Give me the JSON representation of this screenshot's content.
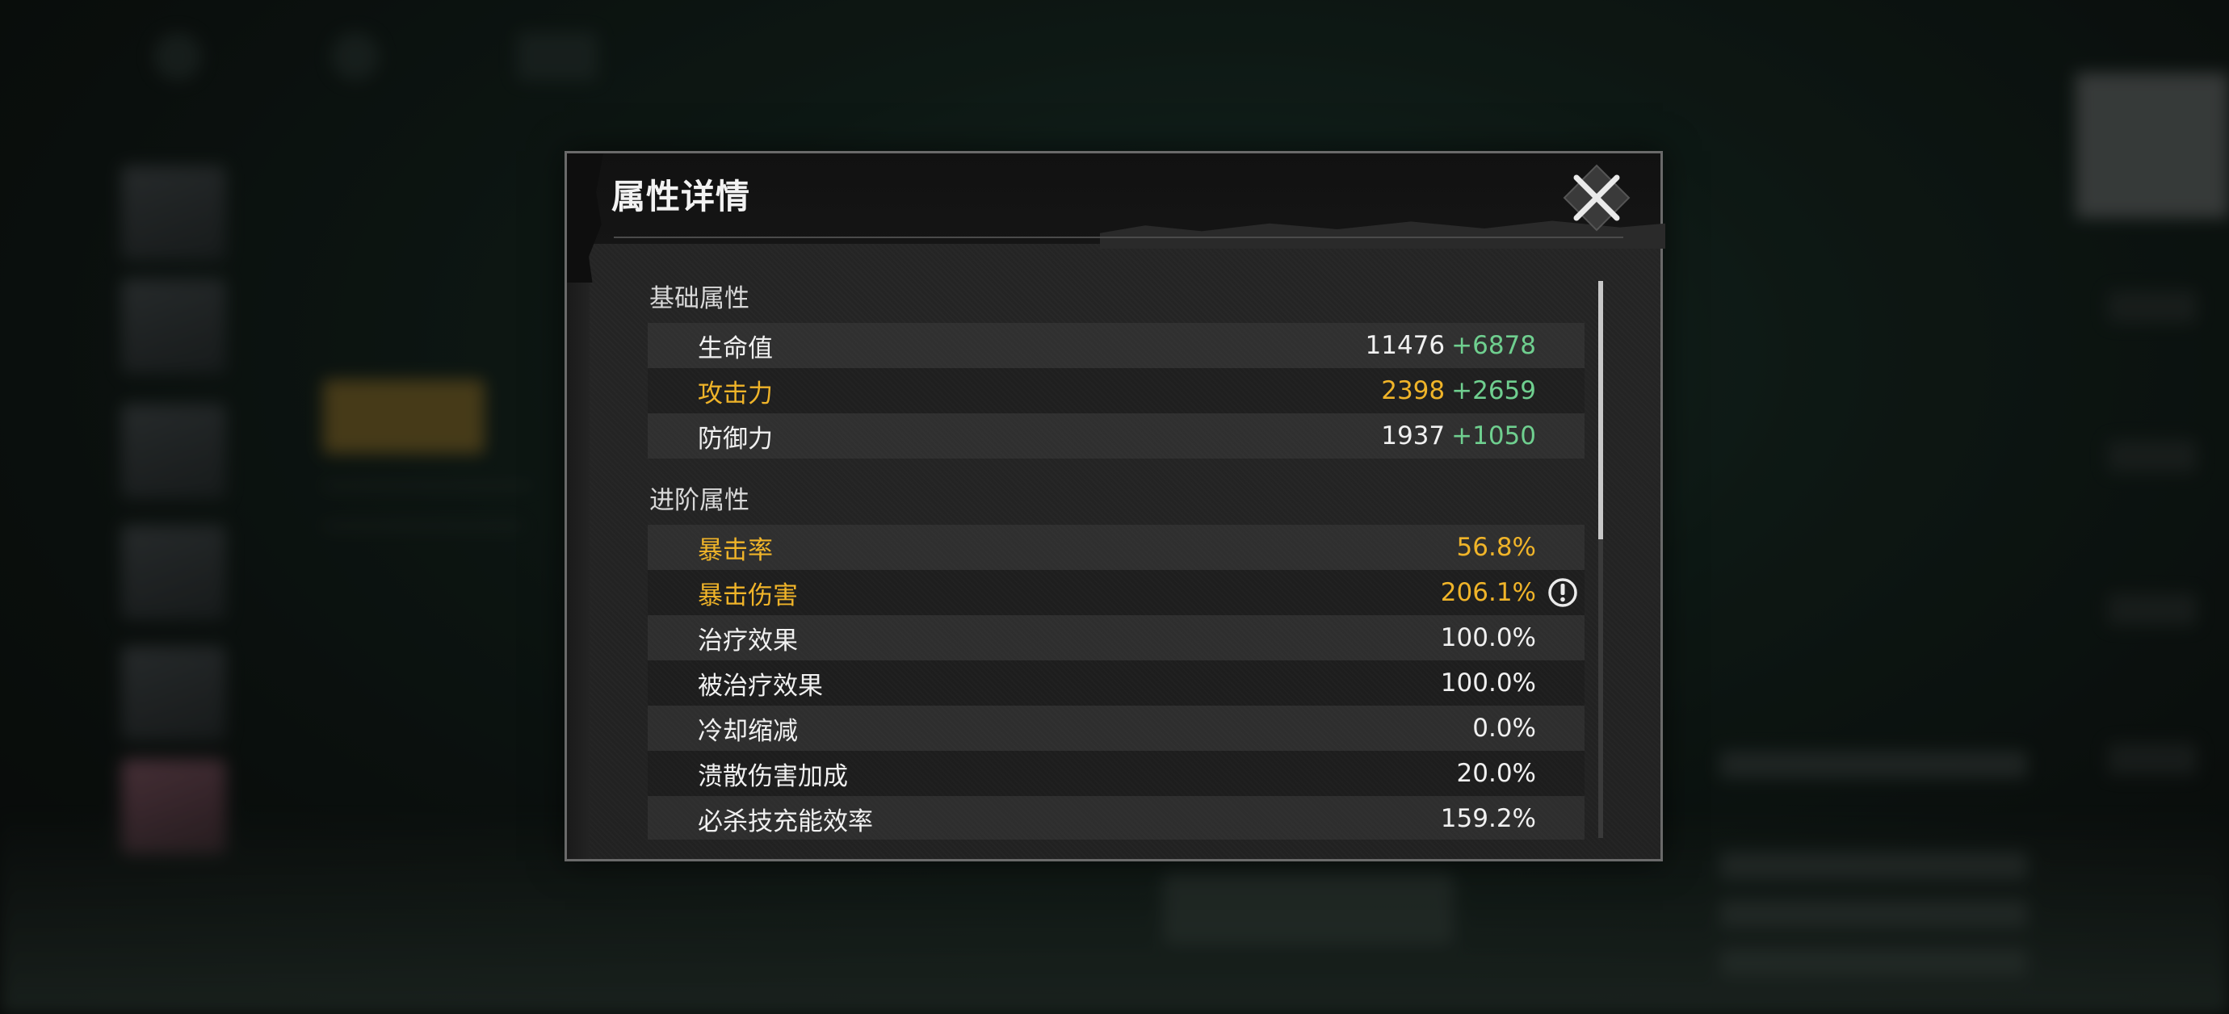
{
  "modal": {
    "title": "属性详情"
  },
  "sections": {
    "basic": {
      "title": "基础属性",
      "rows": [
        {
          "label": "生命值",
          "value": "11476",
          "bonus": "+6878",
          "highlight": false
        },
        {
          "label": "攻击力",
          "value": "2398",
          "bonus": "+2659",
          "highlight": true
        },
        {
          "label": "防御力",
          "value": "1937",
          "bonus": "+1050",
          "highlight": false
        }
      ]
    },
    "advanced": {
      "title": "进阶属性",
      "rows": [
        {
          "label": "暴击率",
          "value": "56.8%",
          "highlight": true
        },
        {
          "label": "暴击伤害",
          "value": "206.1%",
          "highlight": true,
          "icon": "warning-circle-icon"
        },
        {
          "label": "治疗效果",
          "value": "100.0%",
          "highlight": false
        },
        {
          "label": "被治疗效果",
          "value": "100.0%",
          "highlight": false
        },
        {
          "label": "冷却缩减",
          "value": "0.0%",
          "highlight": false
        },
        {
          "label": "溃散伤害加成",
          "value": "20.0%",
          "highlight": false
        },
        {
          "label": "必杀技充能效率",
          "value": "159.2%",
          "highlight": false
        }
      ]
    }
  },
  "colors": {
    "highlight": "#f0b429",
    "bonus": "#6fcf8f",
    "text": "#f0f0f0"
  },
  "icons": {
    "close": "close-x-icon",
    "warning": "warning-circle-icon"
  }
}
